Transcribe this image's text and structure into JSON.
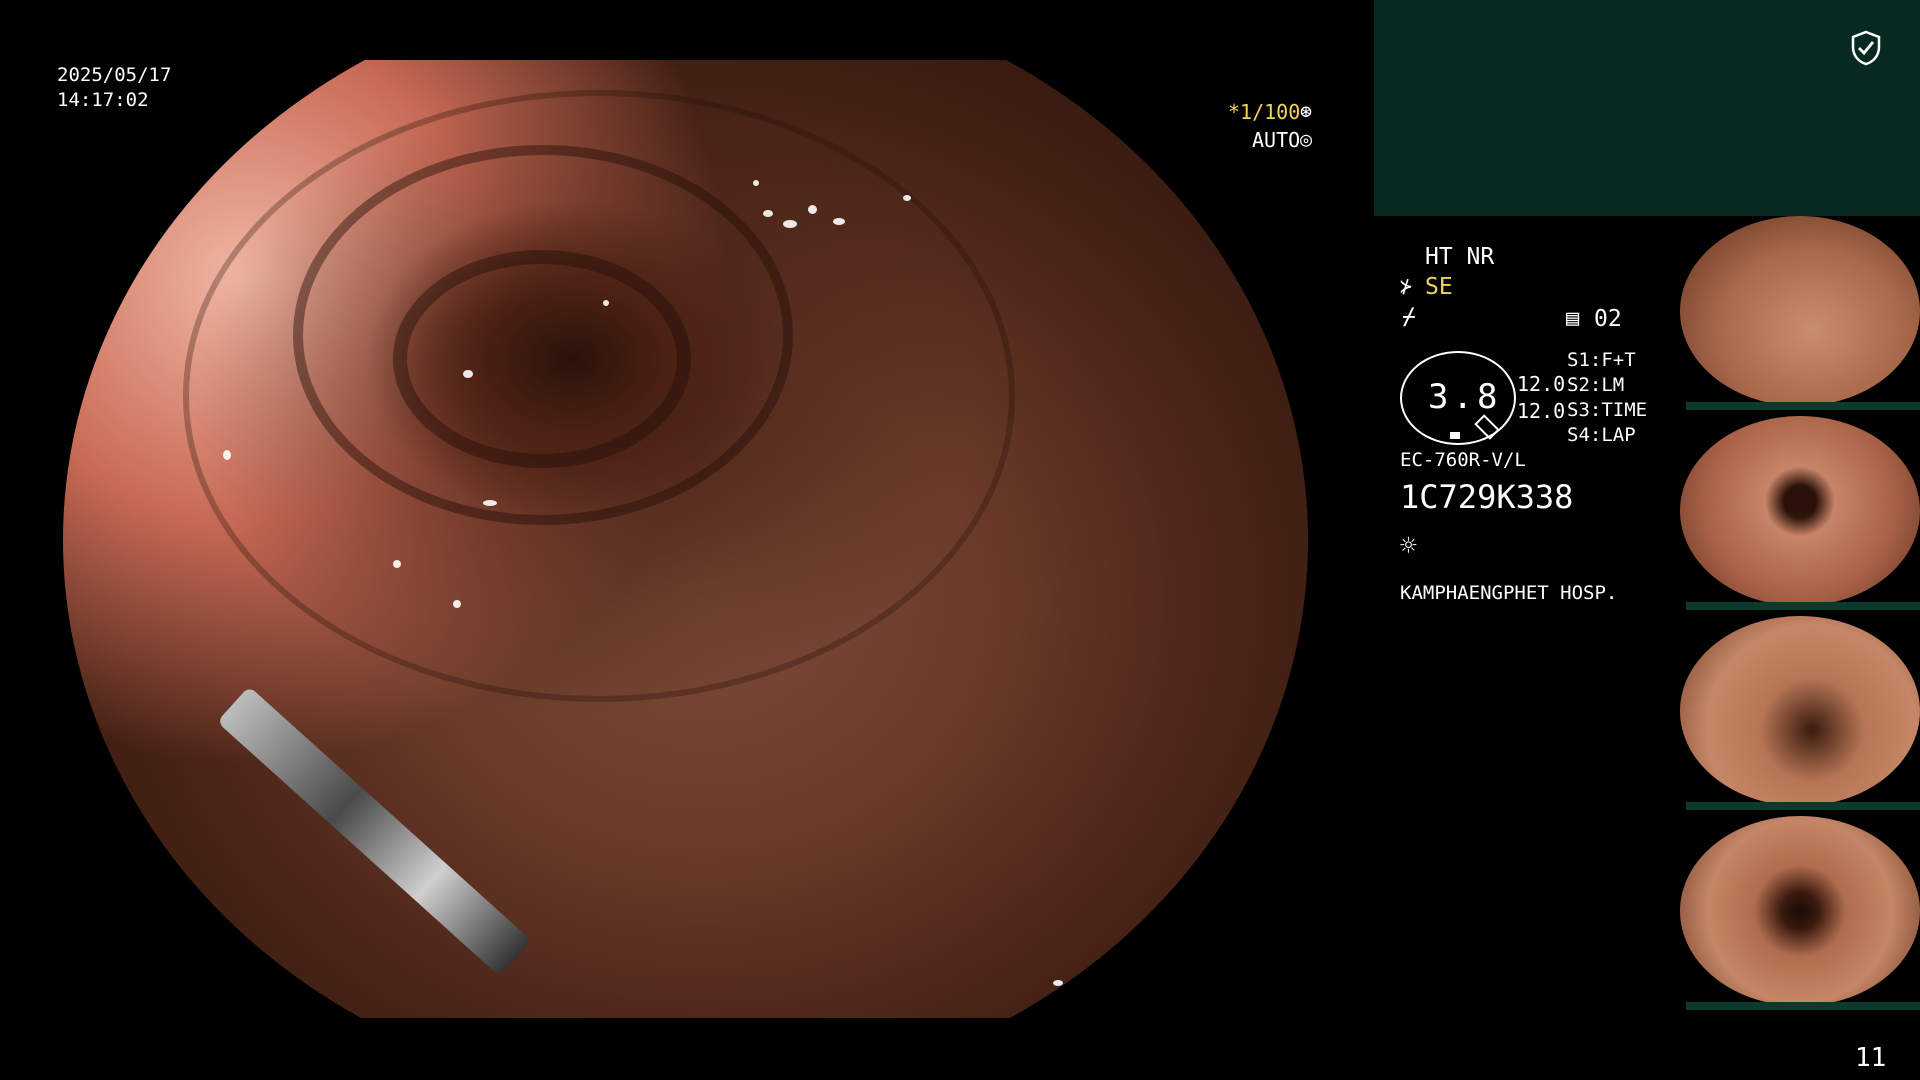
{
  "overlay": {
    "date": "2025/05/17",
    "time": "14:17:02",
    "shutter": "*1/100",
    "auto": "AUTO"
  },
  "panel": {
    "mode_line": "HT NR",
    "se": "SE",
    "page": "02",
    "circle_value": "3.8",
    "value_a": "12.0",
    "value_b": "12.0",
    "s1": "S1:F+T",
    "s2": "S2:LM",
    "s3": "S3:TIME",
    "s4": "S4:LAP",
    "scope_model": "EC-760R-V/L",
    "serial": "1C729K338",
    "hospital": "KAMPHAENGPHET HOSP."
  },
  "footer": {
    "page_number": "11"
  },
  "icons": [
    "shield-check-icon",
    "brightness-icon",
    "shutter-icon",
    "auto-icon",
    "scope-icon",
    "tool-icon",
    "doc-icon"
  ],
  "colors": {
    "background": "#000000",
    "teal_box": "#062a20",
    "shutter_text": "#f2d35a",
    "se_text": "#f2d35a"
  }
}
